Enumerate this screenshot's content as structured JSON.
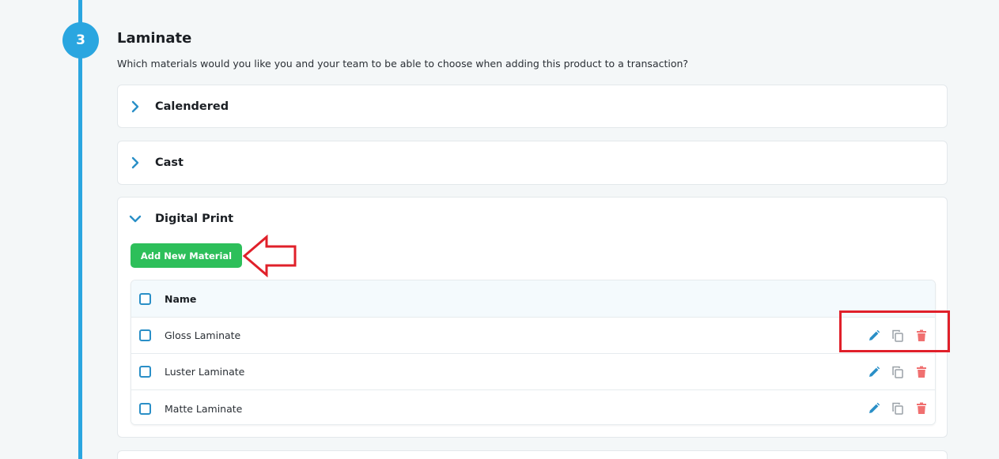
{
  "step": {
    "number": "3"
  },
  "section": {
    "title": "Laminate",
    "description": "Which materials would you like you and your team to be able to choose when adding this product to a transaction?"
  },
  "accordions": [
    {
      "label": "Calendered",
      "expanded": false
    },
    {
      "label": "Cast",
      "expanded": false
    },
    {
      "label": "Digital Print",
      "expanded": true
    }
  ],
  "digital_print": {
    "add_button_label": "Add New Material",
    "table": {
      "column_header": "Name",
      "rows": [
        {
          "name": "Gloss Laminate"
        },
        {
          "name": "Luster Laminate"
        },
        {
          "name": "Matte Laminate"
        }
      ]
    }
  },
  "colors": {
    "accent": "#2aa6e0",
    "primary_button": "#2dbf5a",
    "delete_icon": "#f07070",
    "annotation": "#e0202a"
  },
  "icons": {
    "collapsed": "chevron-right-icon",
    "expanded": "chevron-down-icon",
    "edit": "pencil-icon",
    "duplicate": "copy-icon",
    "delete": "trash-icon"
  }
}
